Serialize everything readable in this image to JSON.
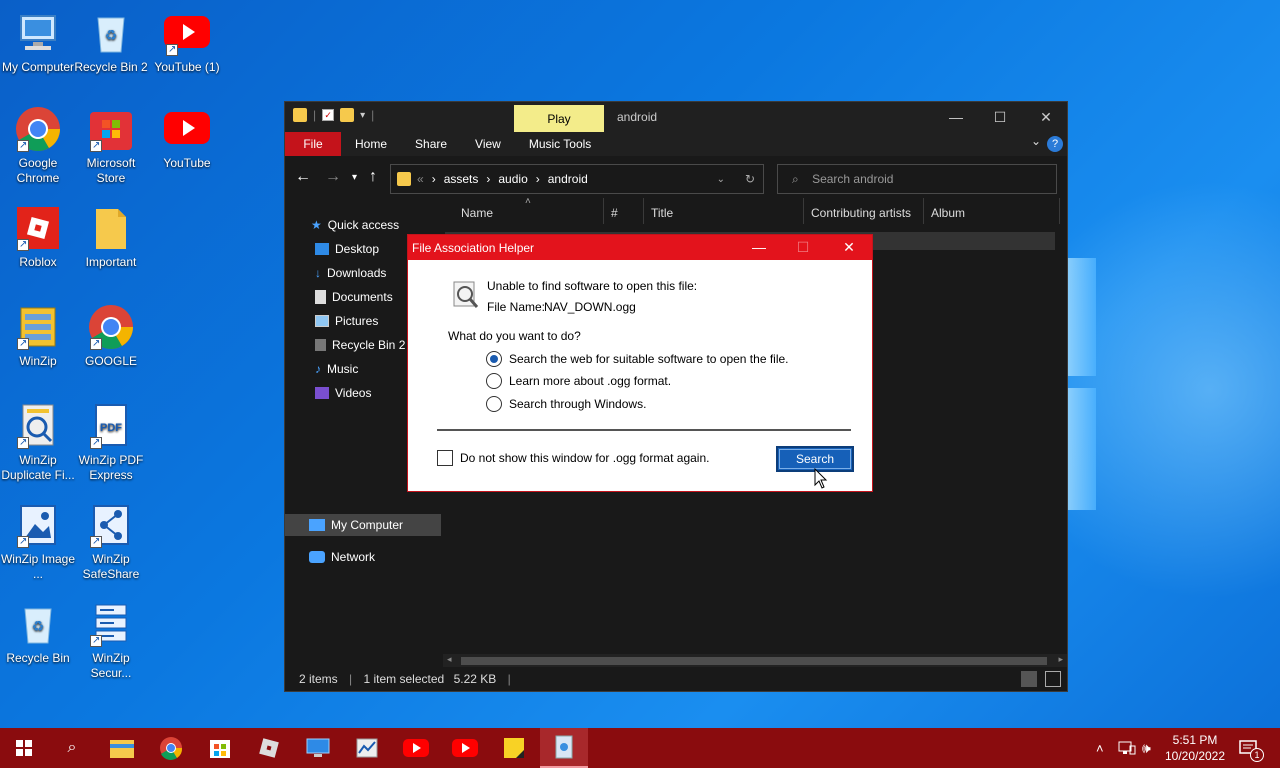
{
  "desktop": {
    "icons": [
      {
        "label": "My Computer",
        "icon": "computer-icon"
      },
      {
        "label": "Recycle Bin 2",
        "icon": "recycle-bin-icon"
      },
      {
        "label": "YouTube (1)",
        "icon": "youtube-icon"
      },
      {
        "label": "Google Chrome",
        "icon": "chrome-icon"
      },
      {
        "label": "Microsoft Store",
        "icon": "store-icon"
      },
      {
        "label": "YouTube",
        "icon": "youtube-icon"
      },
      {
        "label": "Roblox",
        "icon": "roblox-icon"
      },
      {
        "label": "Important",
        "icon": "folder-icon"
      },
      {
        "label": "WinZip",
        "icon": "winzip-icon"
      },
      {
        "label": "GOOGLE",
        "icon": "chrome-icon"
      },
      {
        "label": "WinZip Duplicate Fi...",
        "icon": "winzip-duplicate-icon"
      },
      {
        "label": "WinZip PDF Express",
        "icon": "pdf-icon"
      },
      {
        "label": "WinZip Image ...",
        "icon": "winzip-image-icon"
      },
      {
        "label": "WinZip SafeShare",
        "icon": "share-icon"
      },
      {
        "label": "Recycle Bin",
        "icon": "recycle-bin-icon"
      },
      {
        "label": "WinZip Secur...",
        "icon": "server-icon"
      }
    ]
  },
  "explorer": {
    "title": "android",
    "context_tab": "Play",
    "ribbon_tabs": [
      "File",
      "Home",
      "Share",
      "View",
      "Music Tools"
    ],
    "breadcrumb": [
      "assets",
      "audio",
      "android"
    ],
    "breadcrumb_prefix": "«",
    "search_placeholder": "Search android",
    "nav": [
      {
        "label": "Quick access",
        "icon": "star-icon"
      },
      {
        "label": "Desktop",
        "icon": "desktop-icon"
      },
      {
        "label": "Downloads",
        "icon": "download-icon"
      },
      {
        "label": "Documents",
        "icon": "document-icon"
      },
      {
        "label": "Pictures",
        "icon": "pictures-icon"
      },
      {
        "label": "Recycle Bin 2",
        "icon": "recycle-bin-icon"
      },
      {
        "label": "Music",
        "icon": "music-icon"
      },
      {
        "label": "Videos",
        "icon": "video-icon"
      },
      {
        "label": "My Computer",
        "icon": "computer-icon"
      },
      {
        "label": "Network",
        "icon": "network-icon"
      }
    ],
    "columns": [
      "Name",
      "#",
      "Title",
      "Contributing artists",
      "Album"
    ],
    "status": {
      "items": "2 items",
      "selected": "1 item selected",
      "size": "5.22 KB"
    }
  },
  "dialog": {
    "title": "File Association Helper",
    "message": "Unable to find software to open this file:",
    "file_label": "File Name:",
    "file_name": "NAV_DOWN.ogg",
    "question": "What do you want to do?",
    "options": [
      {
        "label": "Search the web for suitable software to open the file.",
        "selected": true
      },
      {
        "label": "Learn more about .ogg format.",
        "selected": false
      },
      {
        "label": "Search through Windows.",
        "selected": false
      }
    ],
    "checkbox_label": "Do not show this window for .ogg format again.",
    "button": "Search"
  },
  "taskbar": {
    "time": "5:51 PM",
    "date": "10/20/2022",
    "notification_count": "1"
  },
  "colors": {
    "accent_red": "#e3131c",
    "taskbar": "#8a0c0e",
    "button_blue": "#1660b8"
  }
}
